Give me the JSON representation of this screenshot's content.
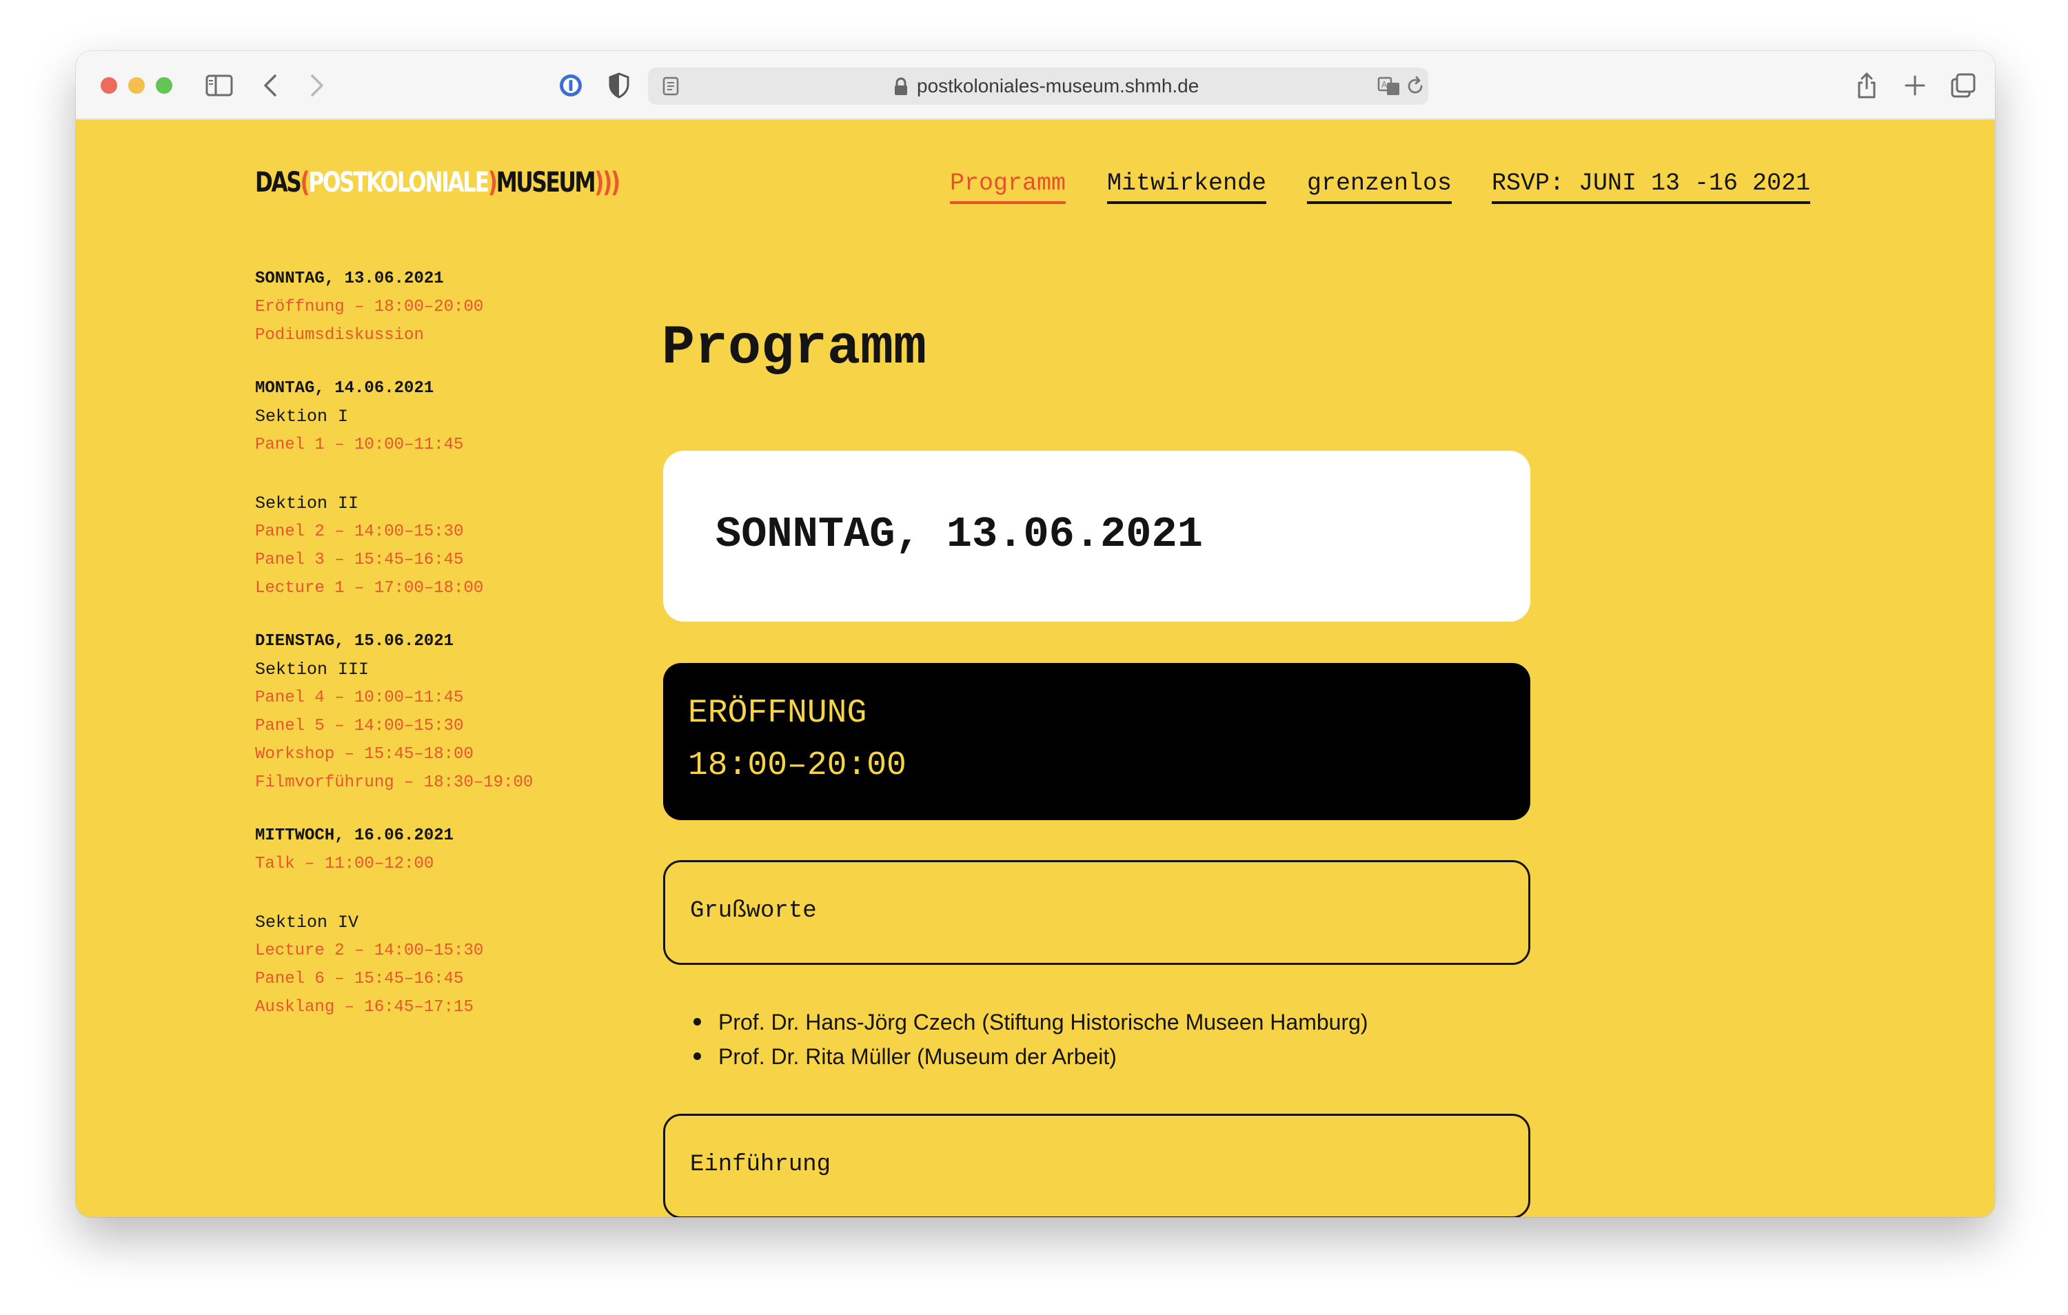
{
  "browser": {
    "url": "postkoloniales-museum.shmh.de"
  },
  "site": {
    "logo": {
      "part1": "DAS",
      "open_bracket": "(",
      "part2": "POSTKOLONIALE",
      "close_bracket": ")",
      "part3": "MUSEUM",
      "tail": ")))"
    },
    "nav": [
      {
        "label": "Programm"
      },
      {
        "label": "Mitwirkende"
      },
      {
        "label": "grenzenlos"
      },
      {
        "label": "RSVP: JUNI 13 -16 2021"
      }
    ]
  },
  "schedule": [
    {
      "day": "SONNTAG, 13.06.2021",
      "blocks": [
        {
          "section": "",
          "entries": [
            "Eröffnung – 18:00–20:00",
            "Podiumsdiskussion"
          ]
        }
      ]
    },
    {
      "day": "MONTAG, 14.06.2021",
      "blocks": [
        {
          "section": "Sektion I",
          "entries": [
            "Panel 1 – 10:00–11:45"
          ]
        },
        {
          "section": "Sektion II",
          "entries": [
            "Panel 2 – 14:00–15:30",
            "Panel 3 – 15:45–16:45",
            "Lecture 1 – 17:00–18:00"
          ]
        }
      ]
    },
    {
      "day": "DIENSTAG, 15.06.2021",
      "blocks": [
        {
          "section": "Sektion III",
          "entries": [
            "Panel 4 – 10:00–11:45",
            "Panel 5 – 14:00–15:30",
            "Workshop – 15:45–18:00",
            "Filmvorführung – 18:30–19:00"
          ]
        }
      ]
    },
    {
      "day": "MITTWOCH, 16.06.2021",
      "blocks": [
        {
          "section": "",
          "entries": [
            "Talk – 11:00–12:00"
          ]
        },
        {
          "section": "Sektion IV",
          "entries": [
            "Lecture 2 – 14:00–15:30",
            "Panel 6 – 15:45–16:45",
            "Ausklang – 16:45–17:15"
          ]
        }
      ]
    }
  ],
  "main": {
    "title": "Programm",
    "date_card": "SONNTAG, 13.06.2021",
    "event": {
      "name": "ERÖFFNUNG",
      "time": "18:00–20:00"
    },
    "grussworte": {
      "label": "Grußworte",
      "speakers": [
        "Prof. Dr. Hans-Jörg Czech (Stiftung Historische Museen Hamburg)",
        "Prof. Dr. Rita Müller (Museum der Arbeit)"
      ]
    },
    "einfuehrung": {
      "label": "Einführung"
    }
  },
  "colors": {
    "background": "#f6d347",
    "accent": "#e8522b",
    "text": "#141414",
    "event_card": "#000000"
  }
}
